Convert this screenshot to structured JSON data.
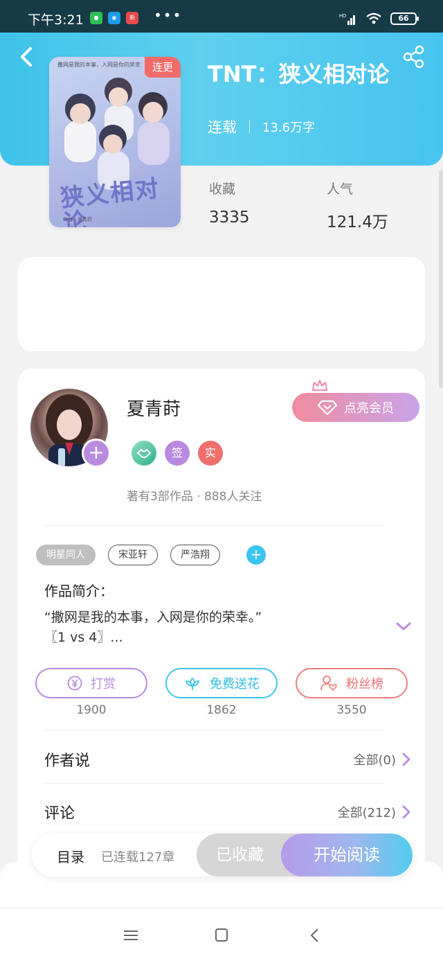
{
  "status": {
    "time": "下午3:21",
    "battery": "66",
    "app_icons": [
      "wechat-icon",
      "app-icon",
      "news-icon"
    ],
    "more": "•••"
  },
  "book": {
    "title": "TNT：狭义相对论",
    "status": "连载",
    "words": "13.6万字",
    "cover": {
      "badge": "连更",
      "title": "狭义相对论",
      "tagline": "撒网是我的本事，入网是你的荣幸",
      "footer": "作者：夏青莳"
    }
  },
  "stats": [
    {
      "label": "收藏",
      "value": "3335"
    },
    {
      "label": "人气",
      "value": "121.4万"
    }
  ],
  "author": {
    "name": "夏青莳",
    "vip_label": "点亮会员",
    "badges": [
      "签",
      "实"
    ],
    "stats_text": "著有3部作品 · 888人关注"
  },
  "tags": [
    "明星同人",
    "宋亚轩",
    "严浩翔"
  ],
  "intro": {
    "title": "作品简介：",
    "line1": "“撒网是我的本事，入网是你的荣幸。”",
    "line2": "〖1 vs 4〗..."
  },
  "actions": [
    {
      "label": "打赏",
      "count": "1900",
      "color": "#b98ae0"
    },
    {
      "label": "免费送花",
      "count": "1862",
      "color": "#3fc7ea"
    },
    {
      "label": "粉丝榜",
      "count": "3550",
      "color": "#ef7e7e"
    }
  ],
  "author_says": {
    "title": "作者说",
    "right": "全部(0)"
  },
  "comments": {
    "title": "评论",
    "right": "全部(212)"
  },
  "read_bar": {
    "catalog": "目录",
    "chapters": "已连载127章",
    "collected": "已收藏",
    "start": "开始阅读"
  },
  "colors": {
    "hero": "#4cc6ee",
    "purple": "#b98ae0",
    "pink": "#f08ca0"
  }
}
